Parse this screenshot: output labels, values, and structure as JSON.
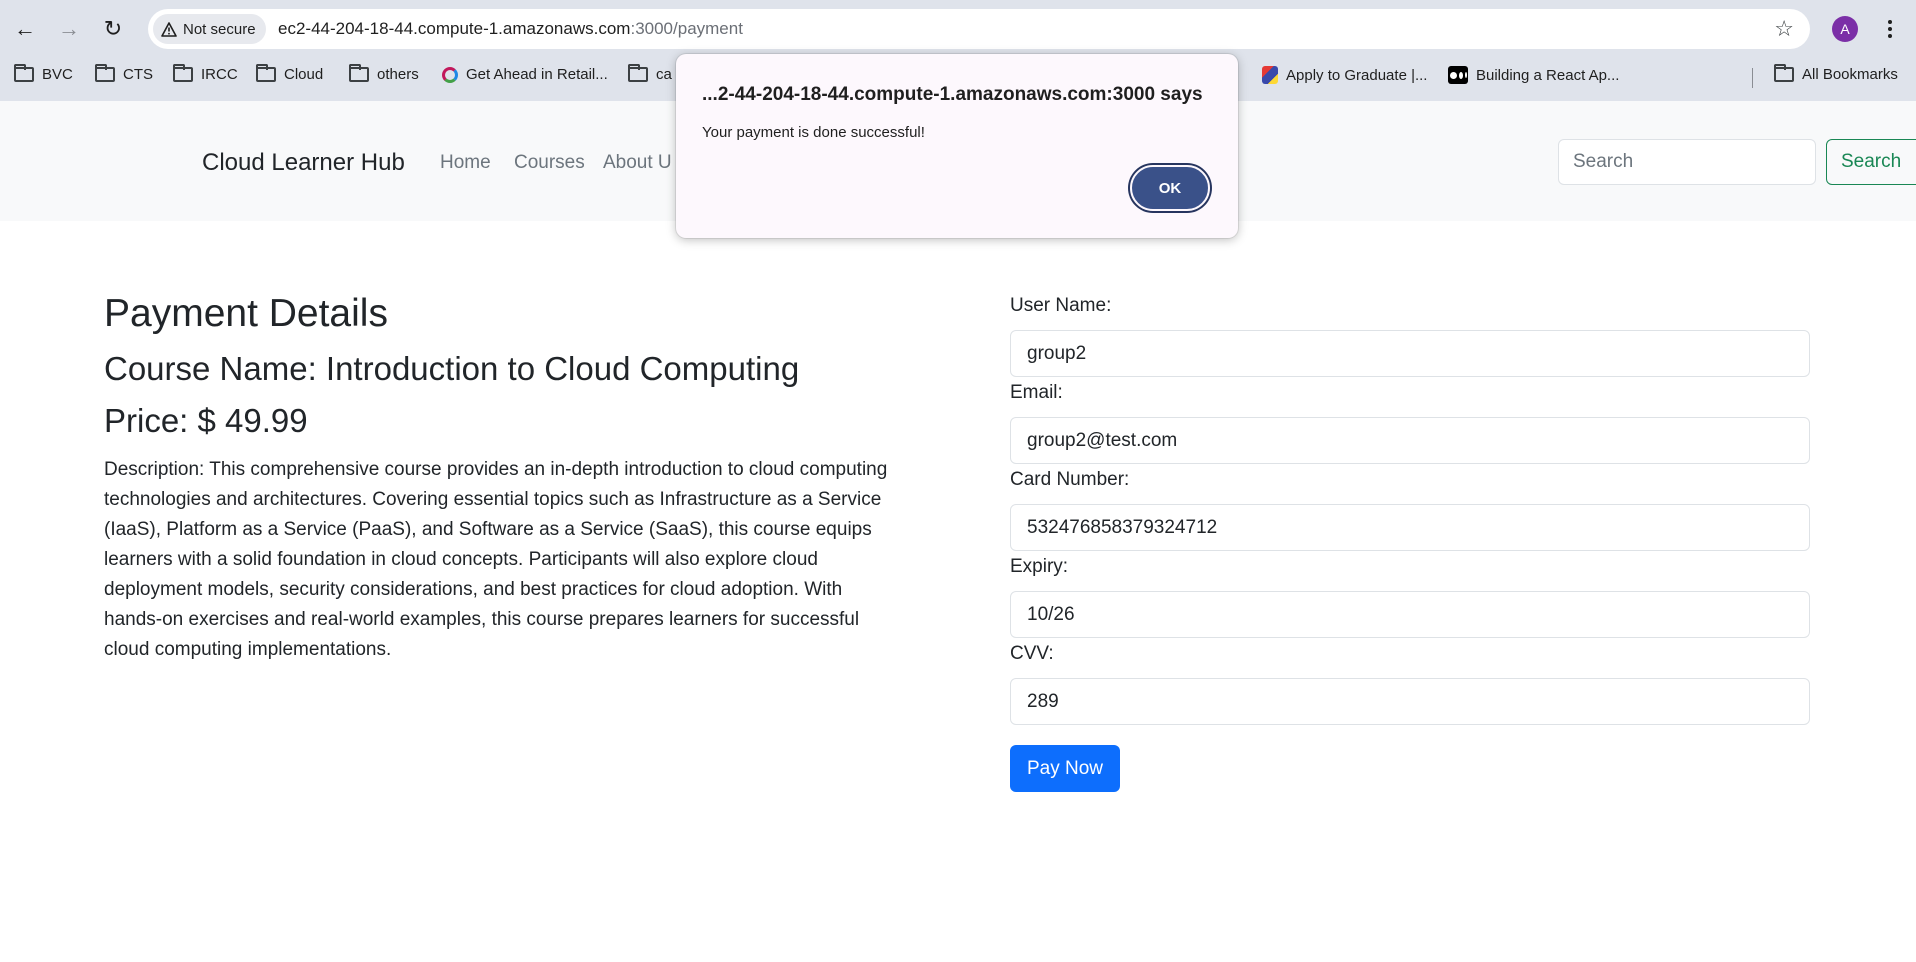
{
  "browser": {
    "security_label": "Not secure",
    "url_host": "ec2-44-204-18-44.compute-1.amazonaws.com",
    "url_path": ":3000/payment",
    "profile_initial": "A",
    "bookmarks": [
      "BVC",
      "CTS",
      "IRCC",
      "Cloud",
      "others",
      "Get Ahead in Retail...",
      "ca",
      "Apply to Graduate |...",
      "Building a React Ap...",
      "All Bookmarks"
    ]
  },
  "site": {
    "brand": "Cloud Learner Hub",
    "nav": [
      "Home",
      "Courses",
      "About U"
    ],
    "search_placeholder": "Search",
    "search_button": "Search"
  },
  "course": {
    "heading": "Payment Details",
    "name_line": "Course Name: Introduction to Cloud Computing",
    "price_line": "Price: $ 49.99",
    "description": "Description: This comprehensive course provides an in-depth introduction to cloud computing technologies and architectures. Covering essential topics such as Infrastructure as a Service (IaaS), Platform as a Service (PaaS), and Software as a Service (SaaS), this course equips learners with a solid foundation in cloud concepts. Participants will also explore cloud deployment models, security considerations, and best practices for cloud adoption. With hands-on exercises and real-world examples, this course prepares learners for successful cloud computing implementations."
  },
  "form": {
    "username_label": "User Name:",
    "username_value": "group2",
    "email_label": "Email:",
    "email_value": "group2@test.com",
    "card_label": "Card Number:",
    "card_value": "532476858379324712",
    "expiry_label": "Expiry:",
    "expiry_value": "10/26",
    "cvv_label": "CVV:",
    "cvv_value": "289",
    "submit_label": "Pay Now"
  },
  "dialog": {
    "title": "...2-44-204-18-44.compute-1.amazonaws.com:3000 says",
    "message": "Your payment is done successful!",
    "ok_label": "OK"
  },
  "colors": {
    "primary": "#0d6efd",
    "success": "#198754",
    "dialog_button": "#3a5189"
  }
}
